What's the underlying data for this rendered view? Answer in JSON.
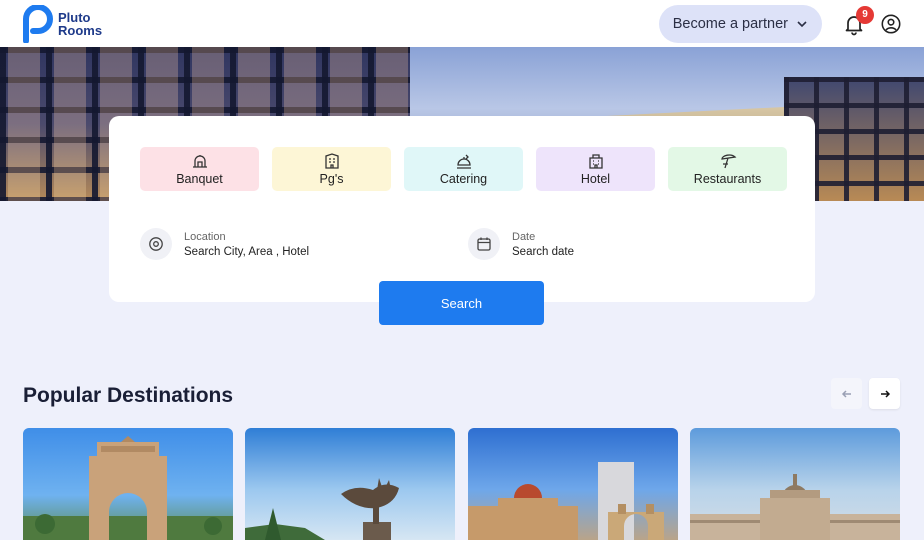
{
  "brand": {
    "line1": "Pluto",
    "line2": "Rooms",
    "color": "#1e3a8a"
  },
  "header": {
    "partner_label": "Become a partner",
    "notification_count": "9"
  },
  "categories": [
    {
      "label": "Banquet",
      "icon": "banquet-icon",
      "bg": "#fde1e6"
    },
    {
      "label": "Pg's",
      "icon": "building-icon",
      "bg": "#fdf6d6"
    },
    {
      "label": "Catering",
      "icon": "catering-icon",
      "bg": "#e0f7f8"
    },
    {
      "label": "Hotel",
      "icon": "hotel-icon",
      "bg": "#eee4fb"
    },
    {
      "label": "Restaurants",
      "icon": "restaurant-icon",
      "bg": "#e3f8e6"
    }
  ],
  "search": {
    "location_label": "Location",
    "location_placeholder": "Search City, Area , Hotel",
    "date_label": "Date",
    "date_placeholder": "Search date",
    "button_label": "Search",
    "button_color": "#1e7bef"
  },
  "popular": {
    "title": "Popular Destinations"
  }
}
